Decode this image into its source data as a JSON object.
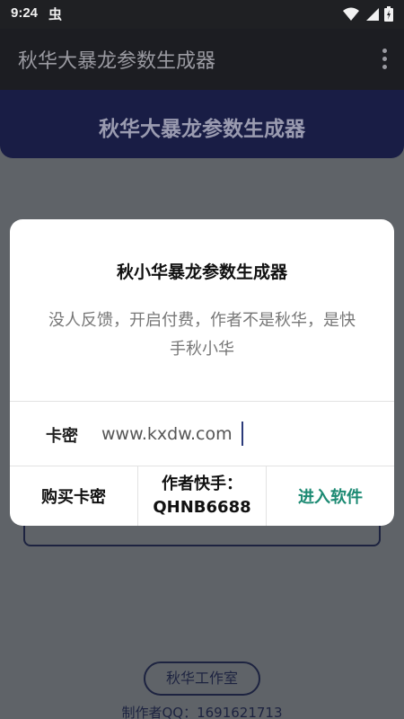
{
  "status_bar": {
    "time": "9:24",
    "notification_glyph": "虫"
  },
  "app_bar": {
    "title": "秋华大暴龙参数生成器"
  },
  "banner": {
    "title": "秋华大暴龙参数生成器"
  },
  "background": {
    "studio_button": "秋华工作室",
    "author_qq": "制作者QQ：1691621713"
  },
  "dialog": {
    "title": "秋小华暴龙参数生成器",
    "message": "没人反馈，开启付费，作者不是秋华，是快手秋小华",
    "key_label": "卡密",
    "key_value": "www.kxdw.com",
    "buy_button": "购买卡密",
    "author_line1": "作者快手：",
    "author_line2": "QHNB6688",
    "enter_button": "进入软件"
  },
  "colors": {
    "scrim": "#5f6368",
    "banner": "#191d45",
    "accent_green": "#1c8a73"
  }
}
